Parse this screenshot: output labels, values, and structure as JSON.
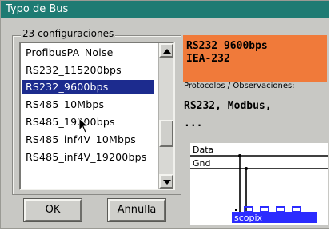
{
  "window": {
    "title": "Typo de Bus"
  },
  "list": {
    "group_label": "23 configuraciones",
    "items": [
      "ProfibusPA_Noise",
      "RS232_115200bps",
      "RS232_9600bps",
      "RS485_10Mbps",
      "RS485_19200bps",
      "RS485_inf4V_10Mbps",
      "RS485_inf4V_19200bps"
    ],
    "selected": "RS232_9600bps"
  },
  "buttons": {
    "ok": "OK",
    "cancel": "Annulla"
  },
  "info": {
    "line1": "RS232 9600bps",
    "line2": "IEA-232"
  },
  "observations": {
    "label": "Protocolos / Observaciones:",
    "line1": "RS232, Modbus,",
    "line2": "..."
  },
  "diagram": {
    "data_label": "Data",
    "gnd_label": "Gnd",
    "device_label": "scopix"
  },
  "colors": {
    "title_bar": "#1e7b73",
    "selection": "#1c2b8e",
    "info_bg": "#f07a3a",
    "device": "#2c2cff"
  },
  "icons": {
    "scroll_up": "triangle-up-icon",
    "scroll_down": "triangle-down-icon",
    "cursor": "mouse-pointer-icon"
  }
}
